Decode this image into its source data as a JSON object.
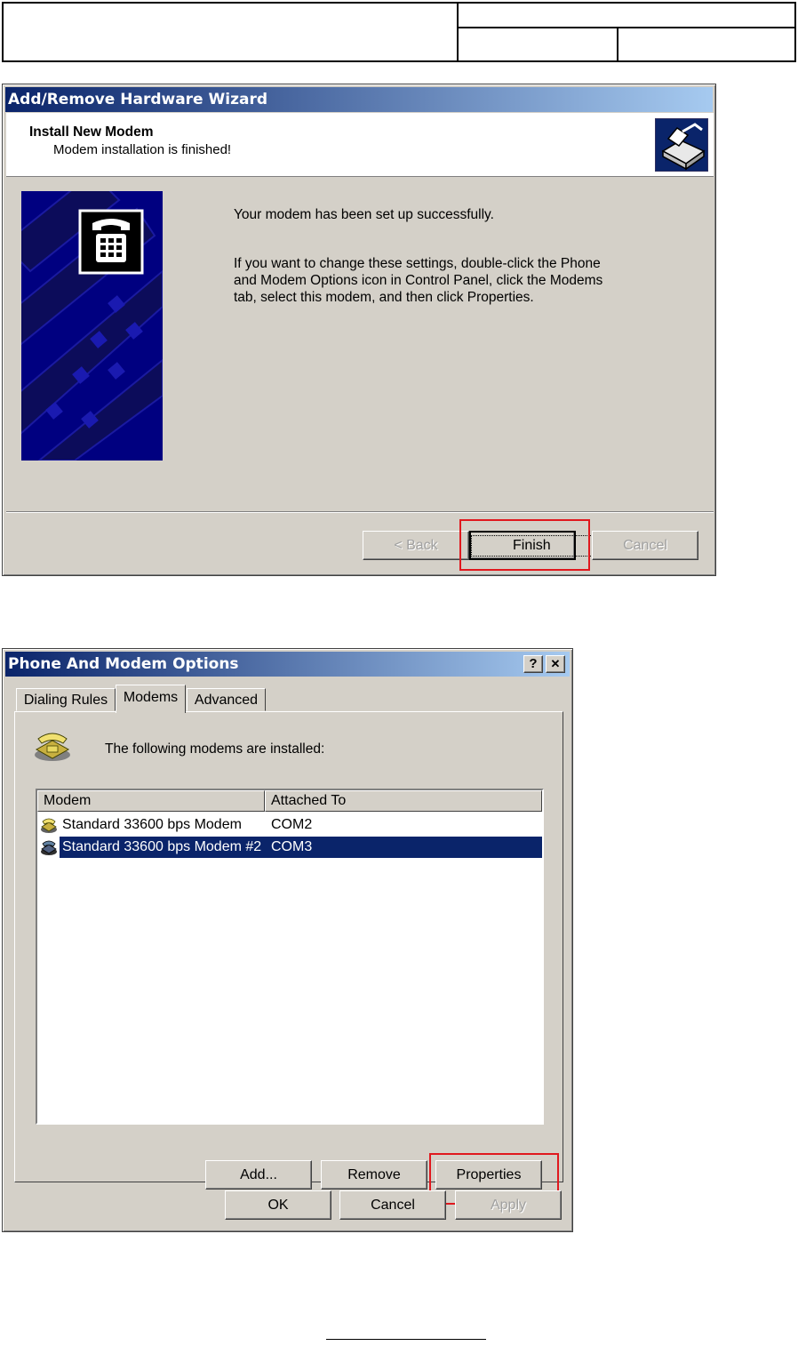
{
  "wizard": {
    "title": "Add/Remove Hardware Wizard",
    "heading": "Install New Modem",
    "subheading": "Modem installation is finished!",
    "message1": "Your modem has been set up successfully.",
    "message2_lines": [
      "If you want to change these settings, double-click the Phone",
      "and Modem Options icon in Control Panel, click the Modems",
      "tab, select this modem, and then click Properties."
    ],
    "buttons": {
      "back": "< Back",
      "finish": "Finish",
      "cancel": "Cancel"
    }
  },
  "phone_modem": {
    "title": "Phone And Modem Options",
    "title_buttons": {
      "help": "?",
      "close": "✕"
    },
    "tabs": [
      "Dialing Rules",
      "Modems",
      "Advanced"
    ],
    "active_tab": "Modems",
    "intro": "The following modems are  installed:",
    "columns": [
      "Modem",
      "Attached To"
    ],
    "rows": [
      {
        "modem": "Standard 33600 bps Modem",
        "port": "COM2",
        "selected": false
      },
      {
        "modem": "Standard 33600 bps Modem #2",
        "port": "COM3",
        "selected": true
      }
    ],
    "buttons": {
      "add": "Add...",
      "remove": "Remove",
      "properties": "Properties",
      "ok": "OK",
      "cancel": "Cancel",
      "apply": "Apply"
    }
  },
  "colors": {
    "highlight": "#e0181e",
    "titlebar": "#0a246a",
    "selection": "#0a246a"
  }
}
